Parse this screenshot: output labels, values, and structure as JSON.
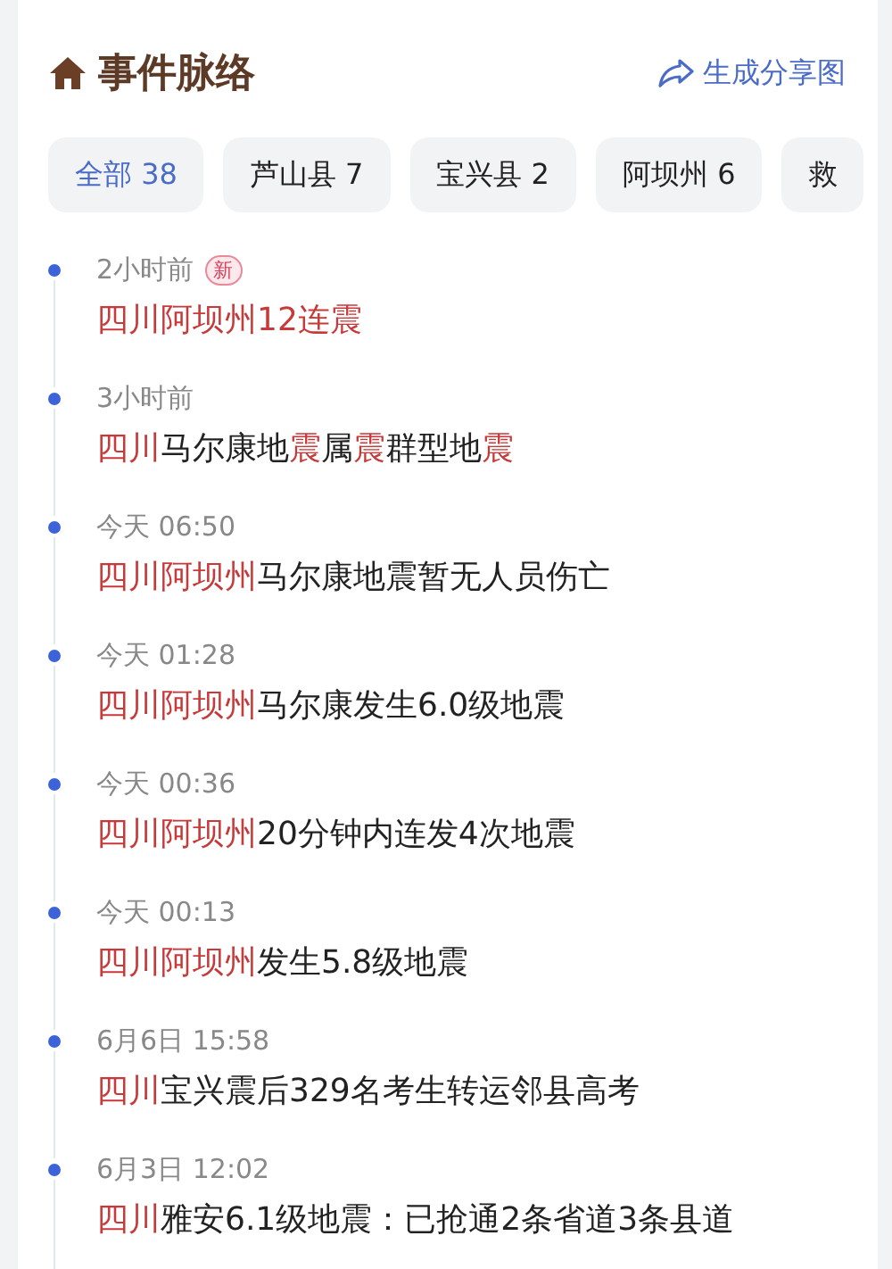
{
  "header": {
    "title": "事件脉络",
    "share": "生成分享图"
  },
  "filters": [
    {
      "label": "全部 38",
      "selected": true
    },
    {
      "label": "芦山县 7",
      "selected": false
    },
    {
      "label": "宝兴县 2",
      "selected": false
    },
    {
      "label": "阿坝州 6",
      "selected": false
    },
    {
      "label": "救",
      "selected": false
    }
  ],
  "events": [
    {
      "time": "2小时前",
      "badge": "新",
      "title": [
        {
          "text": "四川阿坝州12连震",
          "highlight": true
        }
      ]
    },
    {
      "time": "3小时前",
      "title": [
        {
          "text": "四川",
          "highlight": true
        },
        {
          "text": "马尔康地",
          "highlight": false
        },
        {
          "text": "震",
          "highlight": true
        },
        {
          "text": "属",
          "highlight": false
        },
        {
          "text": "震",
          "highlight": true
        },
        {
          "text": "群型地",
          "highlight": false
        },
        {
          "text": "震",
          "highlight": true
        }
      ]
    },
    {
      "time": "今天 06:50",
      "title": [
        {
          "text": "四川阿坝州",
          "highlight": true
        },
        {
          "text": "马尔康地震暂无人员伤亡",
          "highlight": false
        }
      ]
    },
    {
      "time": "今天 01:28",
      "title": [
        {
          "text": "四川阿坝州",
          "highlight": true
        },
        {
          "text": "马尔康发生6.0级地震",
          "highlight": false
        }
      ]
    },
    {
      "time": "今天 00:36",
      "title": [
        {
          "text": "四川阿坝州",
          "highlight": true
        },
        {
          "text": "20分钟内连发4次地震",
          "highlight": false
        }
      ]
    },
    {
      "time": "今天 00:13",
      "title": [
        {
          "text": "四川阿坝州",
          "highlight": true
        },
        {
          "text": "发生5.8级地震",
          "highlight": false
        }
      ]
    },
    {
      "time": "6月6日 15:58",
      "title": [
        {
          "text": "四川",
          "highlight": true
        },
        {
          "text": "宝兴震后329名考生转运邻县高考",
          "highlight": false
        }
      ]
    },
    {
      "time": "6月3日 12:02",
      "title": [
        {
          "text": "四川",
          "highlight": true
        },
        {
          "text": "雅安6.1级地震：已抢通2条省道3条县道",
          "highlight": false
        }
      ]
    }
  ]
}
